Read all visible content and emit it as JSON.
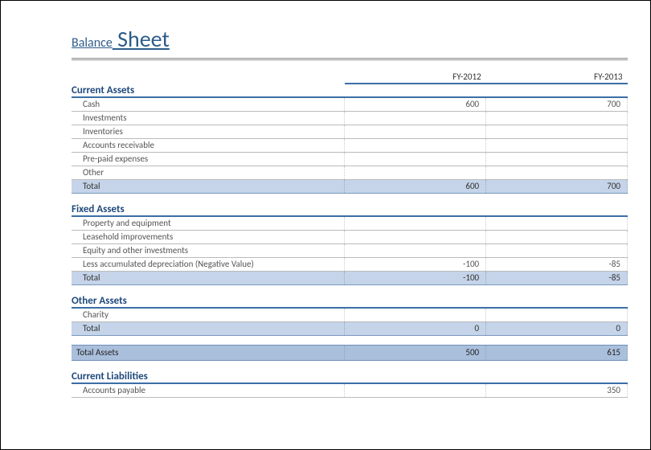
{
  "title": {
    "small": "Balance",
    "large": " Sheet"
  },
  "years": {
    "y1": "FY-2012",
    "y2": "FY-2013"
  },
  "sections": {
    "currentAssets": {
      "heading": "Current Assets",
      "rows": [
        {
          "label": "Cash",
          "v1": "600",
          "v2": "700"
        },
        {
          "label": "Investments",
          "v1": "",
          "v2": ""
        },
        {
          "label": "Inventories",
          "v1": "",
          "v2": ""
        },
        {
          "label": "Accounts receivable",
          "v1": "",
          "v2": ""
        },
        {
          "label": "Pre-paid expenses",
          "v1": "",
          "v2": ""
        },
        {
          "label": "Other",
          "v1": "",
          "v2": ""
        }
      ],
      "total": {
        "label": "Total",
        "v1": "600",
        "v2": "700"
      }
    },
    "fixedAssets": {
      "heading": "Fixed Assets",
      "rows": [
        {
          "label": "Property and equipment",
          "v1": "",
          "v2": ""
        },
        {
          "label": "Leasehold improvements",
          "v1": "",
          "v2": ""
        },
        {
          "label": "Equity and other investments",
          "v1": "",
          "v2": ""
        },
        {
          "label": "Less accumulated depreciation (Negative Value)",
          "v1": "-100",
          "v2": "-85"
        }
      ],
      "total": {
        "label": "Total",
        "v1": "-100",
        "v2": "-85"
      }
    },
    "otherAssets": {
      "heading": "Other Assets",
      "rows": [
        {
          "label": "Charity",
          "v1": "",
          "v2": ""
        }
      ],
      "total": {
        "label": "Total",
        "v1": "0",
        "v2": "0"
      }
    },
    "totalAssets": {
      "label": "Total Assets",
      "v1": "500",
      "v2": "615"
    },
    "currentLiabilities": {
      "heading": "Current Liabilities",
      "rows": [
        {
          "label": "Accounts payable",
          "v1": "",
          "v2": "350"
        }
      ]
    }
  }
}
